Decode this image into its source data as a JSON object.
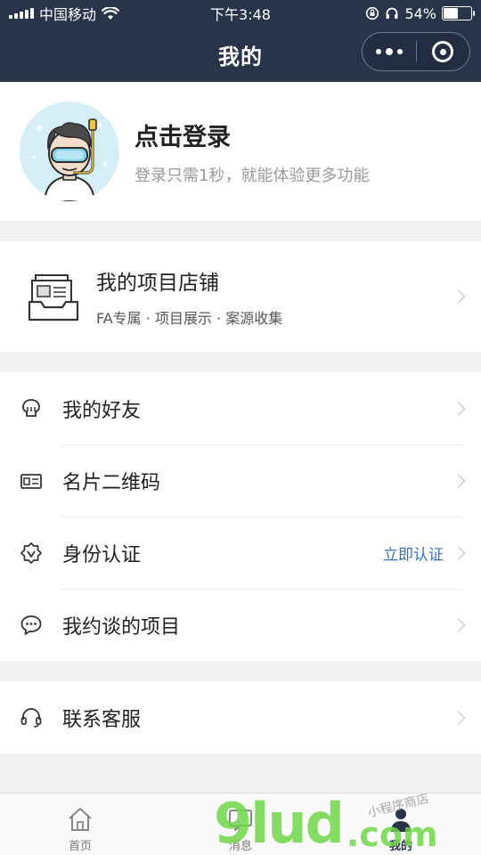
{
  "status_bar": {
    "carrier": "中国移动",
    "time": "下午3:48",
    "battery_percent": "54%",
    "battery_level": 0.54,
    "icons": [
      "signal-icon",
      "wifi-icon",
      "rotation-lock-icon",
      "headphones-icon",
      "battery-icon"
    ]
  },
  "navbar": {
    "title": "我的",
    "menu_icon": "more-dots-icon",
    "close_icon": "target-close-icon"
  },
  "profile": {
    "title": "点击登录",
    "subtitle": "登录只需1秒，就能体验更多功能"
  },
  "store": {
    "title": "我的项目店铺",
    "subtitle": "FA专属 · 项目展示 · 案源收集"
  },
  "menu": {
    "group1": [
      {
        "label": "我的好友",
        "icon": "friends-icon"
      },
      {
        "label": "名片二维码",
        "icon": "id-card-icon"
      },
      {
        "label": "身份认证",
        "icon": "verified-badge-icon",
        "extra": "立即认证"
      },
      {
        "label": "我约谈的项目",
        "icon": "chat-bubble-icon"
      }
    ],
    "group2": [
      {
        "label": "联系客服",
        "icon": "headset-icon"
      }
    ]
  },
  "tabbar": [
    {
      "label": "首页",
      "icon": "home-icon"
    },
    {
      "label": "消息",
      "icon": "message-icon"
    },
    {
      "label": "我的",
      "icon": "profile-icon",
      "active": true
    }
  ],
  "watermark": {
    "main": "9lud",
    "suffix": ".com",
    "small": "小程序商店"
  },
  "colors": {
    "nav_background": "#27344a",
    "page_background": "#f2f2f2",
    "link_blue": "#3a6fb0",
    "watermark_green": "#6fd648"
  }
}
